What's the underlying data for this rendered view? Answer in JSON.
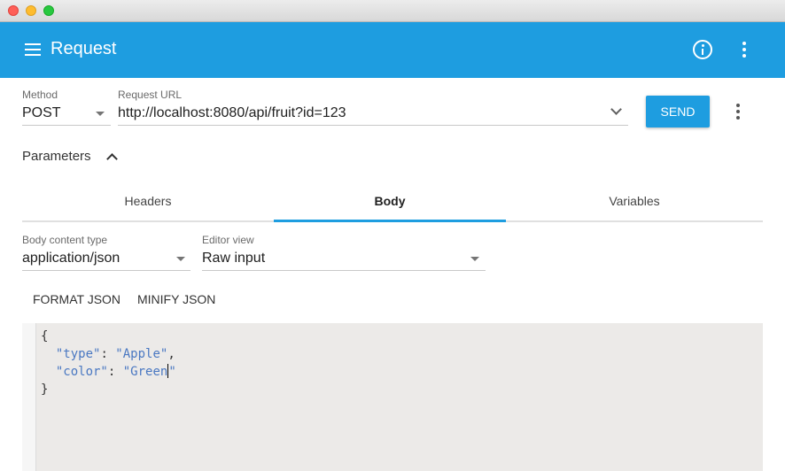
{
  "appbar": {
    "title": "Request",
    "icons": [
      "menu-icon",
      "info-icon",
      "more-vert-icon"
    ]
  },
  "request": {
    "method_label": "Method",
    "method_value": "POST",
    "url_label": "Request URL",
    "url_value": "http://localhost:8080/api/fruit?id=123",
    "send_label": "SEND"
  },
  "parameters": {
    "label": "Parameters",
    "expanded": true
  },
  "tabs": [
    {
      "label": "Headers",
      "active": false
    },
    {
      "label": "Body",
      "active": true
    },
    {
      "label": "Variables",
      "active": false
    }
  ],
  "body": {
    "content_type_label": "Body content type",
    "content_type_value": "application/json",
    "editor_view_label": "Editor view",
    "editor_view_value": "Raw input",
    "format_label": "FORMAT JSON",
    "minify_label": "MINIFY JSON"
  },
  "editor": {
    "open_brace": "{",
    "close_brace": "}",
    "entries": [
      {
        "key": "\"type\"",
        "value": "\"Apple\"",
        "trailing": ","
      },
      {
        "key": "\"color\"",
        "value": "\"Green",
        "after_cursor": "\"",
        "trailing": ""
      }
    ]
  },
  "colors": {
    "accent": "#1e9de0",
    "editor_bg": "#eceae8",
    "json_token": "#4a78c2"
  }
}
